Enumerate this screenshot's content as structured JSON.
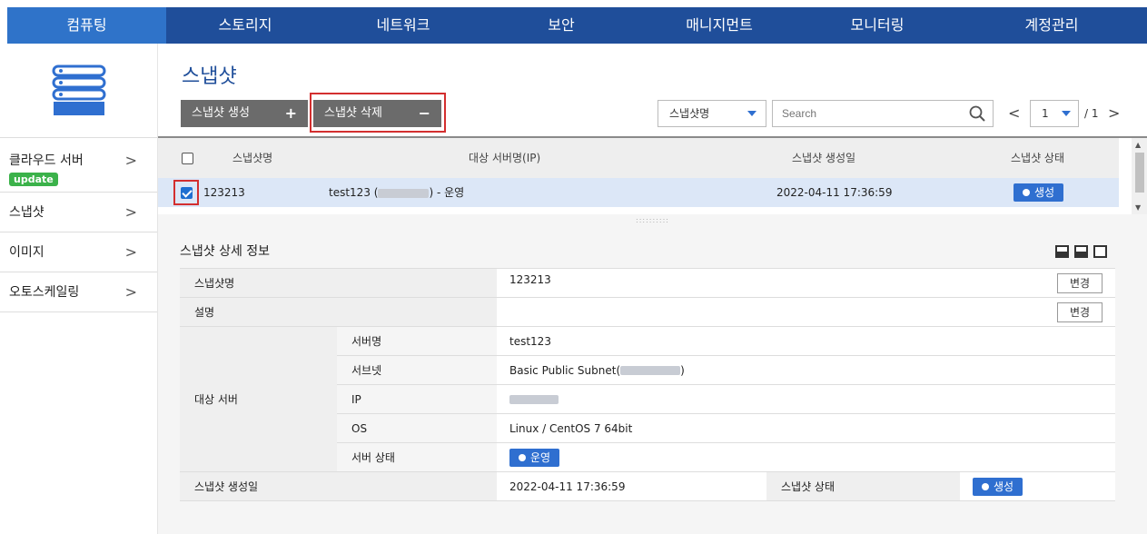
{
  "nav": {
    "items": [
      "컴퓨팅",
      "스토리지",
      "네트워크",
      "보안",
      "매니지먼트",
      "모니터링",
      "계정관리"
    ]
  },
  "sidebar": {
    "items": [
      {
        "label": "클라우드 서버",
        "badge": "update"
      },
      {
        "label": "스냅샷"
      },
      {
        "label": "이미지"
      },
      {
        "label": "오토스케일링"
      }
    ],
    "chevron": ">"
  },
  "page": {
    "title": "스냅샷",
    "create_button": "스냅샷 생성",
    "create_symbol": "+",
    "delete_button": "스냅샷 삭제",
    "delete_symbol": "−"
  },
  "filter": {
    "select_value": "스냅샷명",
    "search_placeholder": "Search"
  },
  "pager": {
    "prev": "<",
    "current": "1",
    "total": "/ 1",
    "next": ">"
  },
  "list": {
    "headers": [
      "스냅샷명",
      "대상 서버명(IP)",
      "스냅샷 생성일",
      "스냅샷 상태"
    ],
    "rows": [
      {
        "name": "123213",
        "server_prefix": "test123 (",
        "server_suffix": ") - 운영",
        "created": "2022-04-11 17:36:59",
        "status": "생성",
        "checked": true
      }
    ]
  },
  "detail": {
    "title": "스냅샷 상세 정보",
    "edit_label": "변경",
    "name_label": "스냅샷명",
    "name_value": "123213",
    "desc_label": "설명",
    "desc_value": "",
    "target_label": "대상 서버",
    "server_name_label": "서버명",
    "server_name_value": "test123",
    "subnet_label": "서브넷",
    "subnet_prefix": "Basic Public Subnet(",
    "subnet_suffix": ")",
    "ip_label": "IP",
    "os_label": "OS",
    "os_value": "Linux / CentOS 7 64bit",
    "server_status_label": "서버 상태",
    "server_status_value": "운영",
    "created_label": "스냅샷 생성일",
    "created_value": "2022-04-11 17:36:59",
    "snap_status_label": "스냅샷 상태",
    "snap_status_value": "생성"
  },
  "colors": {
    "nav_bg": "#1f4e9a",
    "nav_active": "#2f73c9",
    "accent": "#2f6fd0",
    "highlight_frame": "#d32f2f",
    "badge_green": "#3bb24a"
  }
}
